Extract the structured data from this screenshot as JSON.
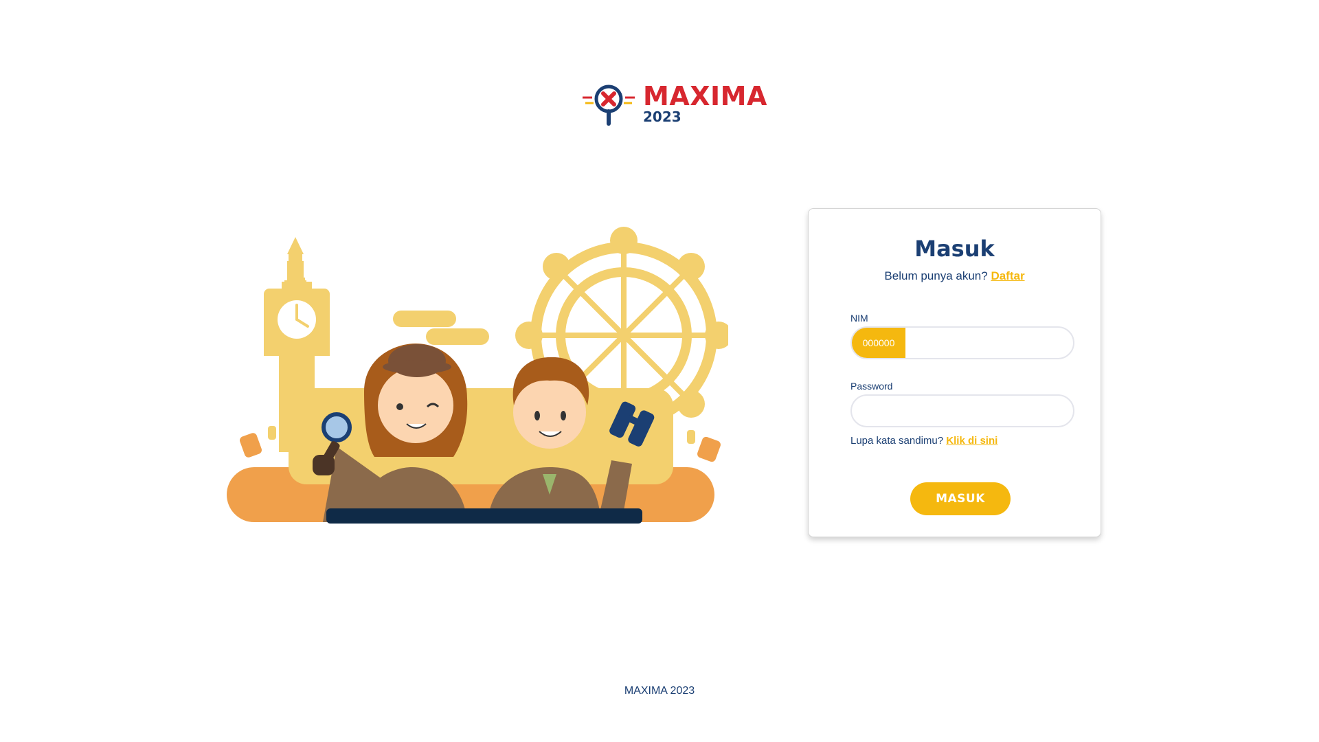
{
  "logo": {
    "title": "MAXIMA",
    "year": "2023"
  },
  "login": {
    "title": "Masuk",
    "no_account_text": "Belum punya akun?",
    "register_link": "Daftar",
    "nim_label": "NIM",
    "nim_prefix": "000000",
    "nim_value": "",
    "password_label": "Password",
    "password_value": "",
    "forgot_text": "Lupa kata sandimu?",
    "forgot_link": "Klik di sini",
    "submit_label": "MASUK"
  },
  "footer": {
    "text": "MAXIMA 2023"
  },
  "colors": {
    "accent": "#f5b80f",
    "navy": "#1b3f73",
    "brand_red": "#d7272f",
    "illustration_yellow": "#f3d06e",
    "illustration_orange": "#f0a04b"
  },
  "illustration": {
    "icons": [
      "big-ben-icon",
      "ferris-wheel-icon",
      "detective-girl-icon",
      "detective-boy-icon",
      "magnifier-icon",
      "binoculars-icon"
    ]
  }
}
